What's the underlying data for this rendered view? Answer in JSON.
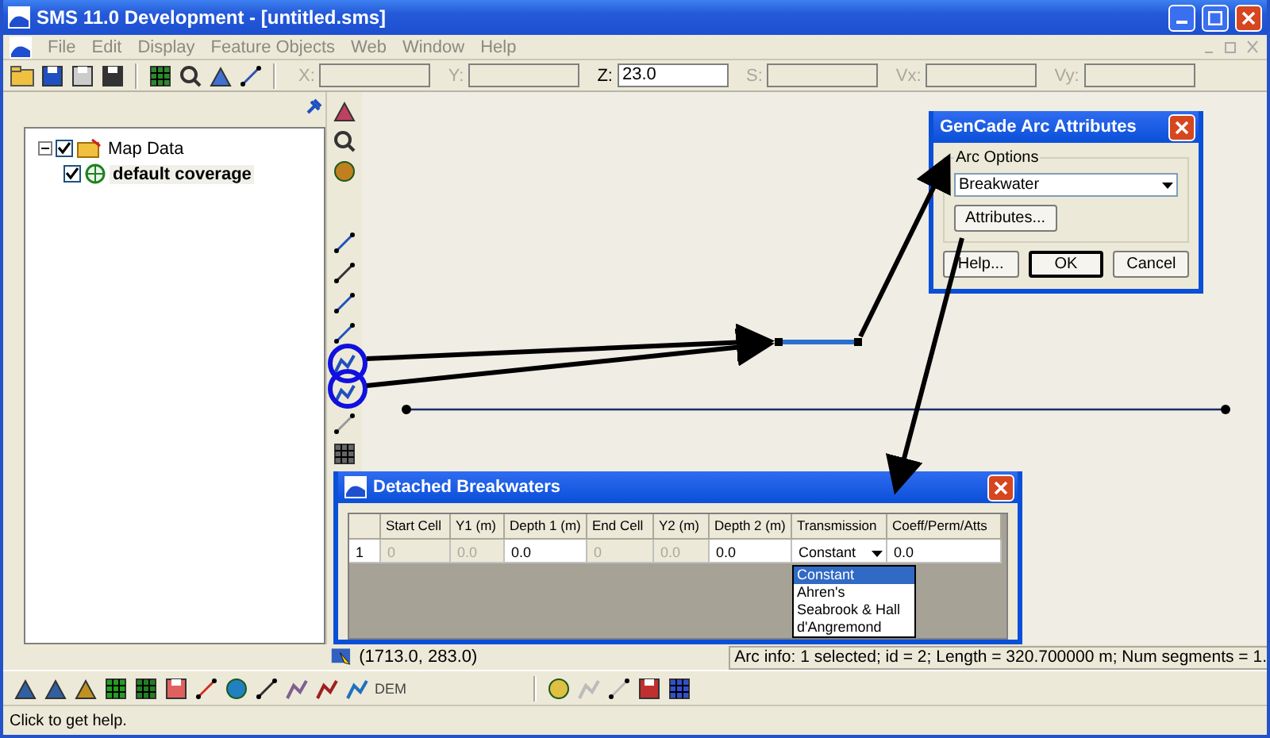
{
  "window": {
    "title": "SMS 11.0 Development - [untitled.sms]"
  },
  "menu": [
    "File",
    "Edit",
    "Display",
    "Feature Objects",
    "Web",
    "Window",
    "Help"
  ],
  "coordinates": [
    {
      "label": "X:",
      "disabled": true
    },
    {
      "label": "Y:",
      "disabled": true
    },
    {
      "label": "Z:",
      "value": "23.0",
      "disabled": false
    },
    {
      "label": "S:",
      "disabled": true
    },
    {
      "label": "Vx:",
      "disabled": true
    },
    {
      "label": "Vy:",
      "disabled": true
    }
  ],
  "tree": [
    {
      "label": "Map Data",
      "checked": true,
      "active": false,
      "expanded": true,
      "children": [
        {
          "label": "default coverage",
          "checked": true,
          "active": true
        }
      ]
    }
  ],
  "arc_dialog": {
    "title": "GenCade Arc Attributes",
    "group": "Arc Options",
    "type_value": "Breakwater",
    "attributes_button": "Attributes...",
    "buttons": [
      {
        "label": "Help...",
        "default": false
      },
      {
        "label": "OK",
        "default": true
      },
      {
        "label": "Cancel",
        "default": false
      }
    ]
  },
  "breakwater_dialog": {
    "title": "Detached Breakwaters",
    "columns": [
      "Start Cell",
      "Y1 (m)",
      "Depth 1 (m)",
      "End Cell",
      "Y2 (m)",
      "Depth 2 (m)",
      "Transmission",
      "Coeff/Perm/Atts"
    ],
    "rows": [
      {
        "number": "1",
        "cells": [
          {
            "text": "0",
            "disabled": true,
            "kind": "text"
          },
          {
            "text": "0.0",
            "disabled": true,
            "kind": "text"
          },
          {
            "text": "0.0",
            "disabled": false,
            "kind": "text"
          },
          {
            "text": "0",
            "disabled": true,
            "kind": "text"
          },
          {
            "text": "0.0",
            "disabled": true,
            "kind": "text"
          },
          {
            "text": "0.0",
            "disabled": false,
            "kind": "text"
          },
          {
            "text": "Constant",
            "disabled": false,
            "kind": "dropdown"
          },
          {
            "text": "0.0",
            "disabled": false,
            "kind": "text"
          }
        ]
      }
    ],
    "dropdown_options": [
      {
        "label": "Constant",
        "selected": true
      },
      {
        "label": "Ahren's",
        "selected": false
      },
      {
        "label": "Seabrook & Hall",
        "selected": false
      },
      {
        "label": "d'Angremond",
        "selected": false
      }
    ]
  },
  "status": {
    "coordinates": "(1713.0, 283.0)",
    "arc_info": "Arc info: 1 selected; id = 2; Length = 320.700000 m; Num segments = 1."
  },
  "bottom_toolbar": {
    "label": "DEM"
  },
  "help_text": "Click to get help."
}
